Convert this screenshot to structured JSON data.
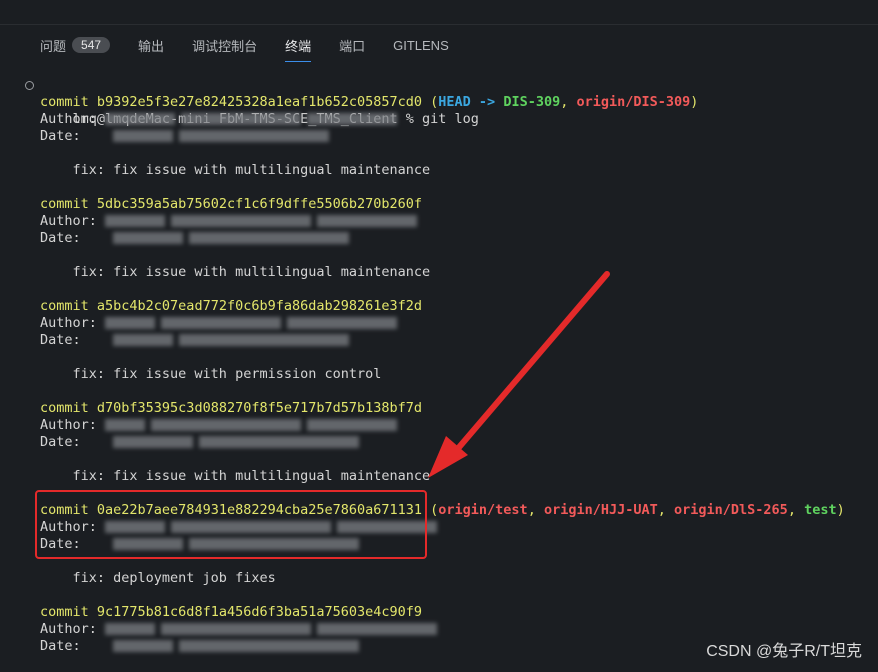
{
  "tabs": [
    {
      "label": "问题",
      "badge": "547"
    },
    {
      "label": "输出"
    },
    {
      "label": "调试控制台"
    },
    {
      "label": "终端"
    },
    {
      "label": "端口"
    },
    {
      "label": "GITLENS"
    }
  ],
  "terminal": {
    "prompt": "lmq@lmqdeMac-mini FbM-TMS-SCE_TMS_Client % git log",
    "commits": [
      {
        "prefix": "commit ",
        "hash": "b9392e5f3e27e82425328a1eaf1b652c05857cd0",
        "refs_head": "HEAD",
        "refs_arrow": " -> ",
        "refs_local": "DIS-309",
        "refs_remote": "origin/DIS-309",
        "author_label": "Author:",
        "date_label": "Date:",
        "message": "    fix: fix issue with multilingual maintenance"
      },
      {
        "prefix": "commit ",
        "hash": "5dbc359a5ab75602cf1c6f9dffe5506b270b260f",
        "author_label": "Author:",
        "date_label": "Date:",
        "message": "    fix: fix issue with multilingual maintenance"
      },
      {
        "prefix": "commit ",
        "hash": "a5bc4b2c07ead772f0c6b9fa86dab298261e3f2d",
        "author_label": "Author:",
        "date_label": "Date:",
        "message": "    fix: fix issue with permission control"
      },
      {
        "prefix": "commit ",
        "hash": "d70bf35395c3d088270f8f5e717b7d57b138bf7d",
        "author_label": "Author:",
        "date_label": "Date:",
        "message": "    fix: fix issue with multilingual maintenance"
      },
      {
        "prefix": "commit ",
        "hash": "0ae22b7aee784931e882294cba25e7860a671131",
        "refs_remote1": "origin/test",
        "refs_remote2": "origin/HJJ-UAT",
        "refs_remote3": "origin/DlS-265",
        "refs_local": "test",
        "author_label": "Author:",
        "date_label": "Date:",
        "message": "    fix: deployment job fixes"
      },
      {
        "prefix": "commit ",
        "hash": "9c1775b81c6d8f1a456d6f3ba51a75603e4c90f9",
        "author_label": "Author:",
        "date_label": "Date:"
      }
    ],
    "refs_open": " (",
    "refs_sep": ", ",
    "refs_close": ")"
  },
  "annotation": {
    "color": "#e42a2a"
  },
  "watermark": "CSDN @兔子R/T坦克"
}
